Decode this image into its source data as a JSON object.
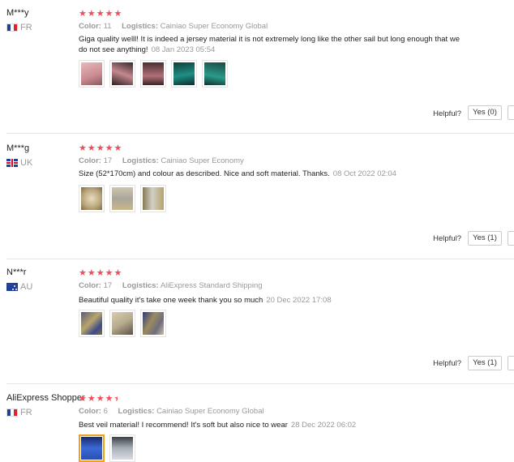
{
  "helpful_label": "Helpful?",
  "reviews": [
    {
      "user": "M***y",
      "country": "FR",
      "flag": "fr",
      "rating_text": "5 stars",
      "color_label": "Color:",
      "color_value": "11",
      "logistics_label": "Logistics:",
      "logistics_value": "Cainiao Super Economy Global",
      "text": "Giga quality welll! It is indeed a jersey material it is not extremely long like the other sail but long enough that we do not see anything!",
      "date": "08 Jan 2023 05:54",
      "yes_label": "Yes (0)",
      "photos": [
        "#c98a8f",
        "#b7787e",
        "#a86a6f",
        "#1f7f74",
        "#2a8a7d"
      ]
    },
    {
      "user": "M***g",
      "country": "UK",
      "flag": "uk",
      "rating_text": "5 stars",
      "color_label": "Color:",
      "color_value": "17",
      "logistics_label": "Logistics:",
      "logistics_value": "Cainiao Super Economy",
      "text": "Size (52*170cm) and colour as described. Nice and soft material. Thanks.",
      "date": "08 Oct 2022 02:04",
      "yes_label": "Yes (1)",
      "photos": [
        "#b9a57a",
        "#a9a59a",
        "#9c927a"
      ]
    },
    {
      "user": "N***r",
      "country": "AU",
      "flag": "au",
      "rating_text": "5 stars",
      "color_label": "Color:",
      "color_value": "17",
      "logistics_label": "Logistics:",
      "logistics_value": "AliExpress Standard Shipping",
      "text": "Beautiful quality it's take one week thank you so much",
      "date": "20 Dec 2022 17:08",
      "yes_label": "Yes (1)",
      "photos": [
        "#8e7f5a",
        "#b7ab8d",
        "#6f6c7e"
      ]
    },
    {
      "user": "AliExpress Shopper",
      "country": "FR",
      "flag": "fr",
      "rating_text": "4.5 stars",
      "color_label": "Color:",
      "color_value": "6",
      "logistics_label": "Logistics:",
      "logistics_value": "Cainiao Super Economy Global",
      "text": "Best veil material! I recommend! It's soft but also nice to wear",
      "date": "28 Dec 2022 06:02",
      "yes_label": "",
      "photos": [
        "#3a6ad8",
        "#a8b0b8"
      ]
    }
  ]
}
